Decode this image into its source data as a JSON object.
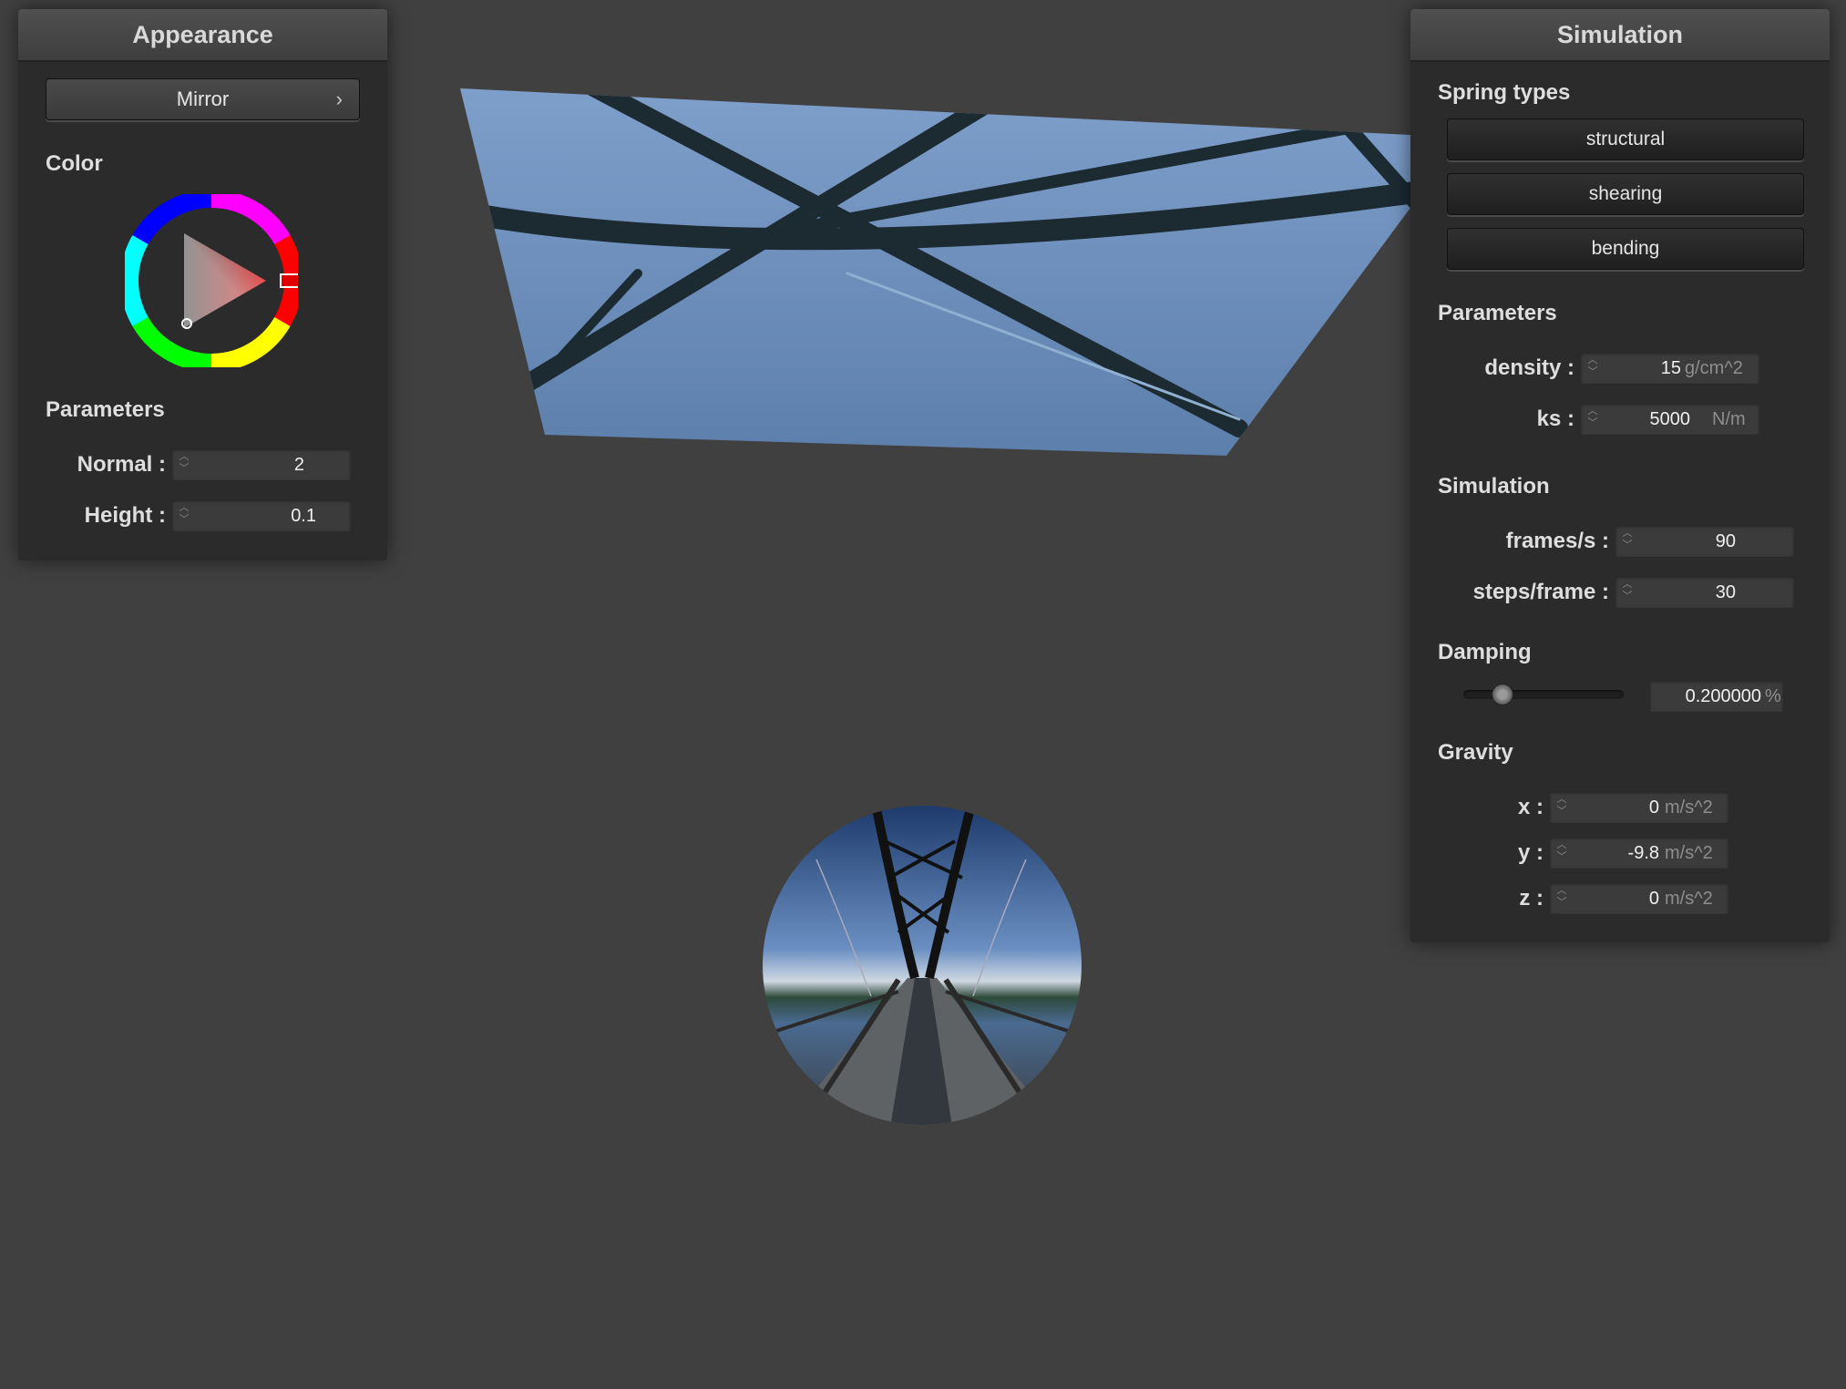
{
  "appearance_panel": {
    "title": "Appearance",
    "shader_button_label": "Mirror",
    "shader_button_chevron": "›",
    "color_section_label": "Color",
    "color_wheel": {
      "selected_hue_color": "#e00000",
      "icon": "color-wheel"
    },
    "parameters_section_label": "Parameters",
    "normal_label": "Normal :",
    "normal_value": "2",
    "height_label": "Height :",
    "height_value": "0.1"
  },
  "simulation_panel": {
    "title": "Simulation",
    "spring_types_label": "Spring types",
    "spring_buttons": [
      "structural",
      "shearing",
      "bending"
    ],
    "parameters_label": "Parameters",
    "density_label": "density :",
    "density_value": "15",
    "density_unit": "g/cm^2",
    "ks_label": "ks :",
    "ks_value": "5000",
    "ks_unit": "N/m",
    "simulation_label": "Simulation",
    "fps_label": "frames/s :",
    "fps_value": "90",
    "steps_label": "steps/frame :",
    "steps_value": "30",
    "damping_label": "Damping",
    "damping_value": "0.200000",
    "damping_unit": "%",
    "damping_fraction": 0.2,
    "gravity_label": "Gravity",
    "gx_label": "x :",
    "gx_value": "0",
    "gy_label": "y :",
    "gy_value": "-9.8",
    "gz_label": "z :",
    "gz_value": "0",
    "gravity_unit": "m/s^2"
  },
  "scene": {
    "cloth": "cloth-mesh-reflection",
    "sphere": "mirror-sphere-bridge-reflection",
    "background_color": "#404040"
  }
}
